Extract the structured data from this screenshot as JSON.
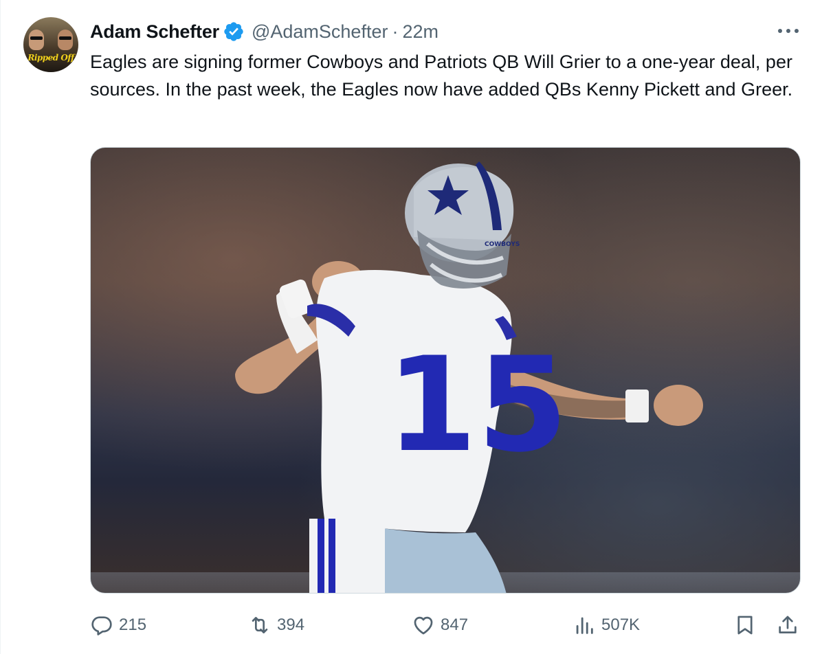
{
  "tweet": {
    "author_name": "Adam Schefter",
    "handle": "@AdamSchefter",
    "separator": "·",
    "time": "22m",
    "text": "Eagles are signing former Cowboys and Patriots QB Will Grier to a one-year deal, per sources. In the past week, the Eagles now have added QBs Kenny Pickett and Greer.",
    "avatar_logo_text": "Ripped Off"
  },
  "media": {
    "jersey_number": "15",
    "helmet_text": "COWBOYS",
    "icon": "photo-of-football-player"
  },
  "actions": {
    "replies": "215",
    "retweets": "394",
    "likes": "847",
    "views": "507K"
  },
  "icons": {
    "verified": "verified-badge-icon",
    "more": "more-options-icon",
    "reply": "reply-icon",
    "retweet": "retweet-icon",
    "like": "heart-icon",
    "views": "views-chart-icon",
    "bookmark": "bookmark-icon",
    "share": "share-icon"
  },
  "colors": {
    "text": "#0f1419",
    "secondary": "#536471",
    "verified": "#1d9bf0",
    "border": "#cfd9de"
  }
}
